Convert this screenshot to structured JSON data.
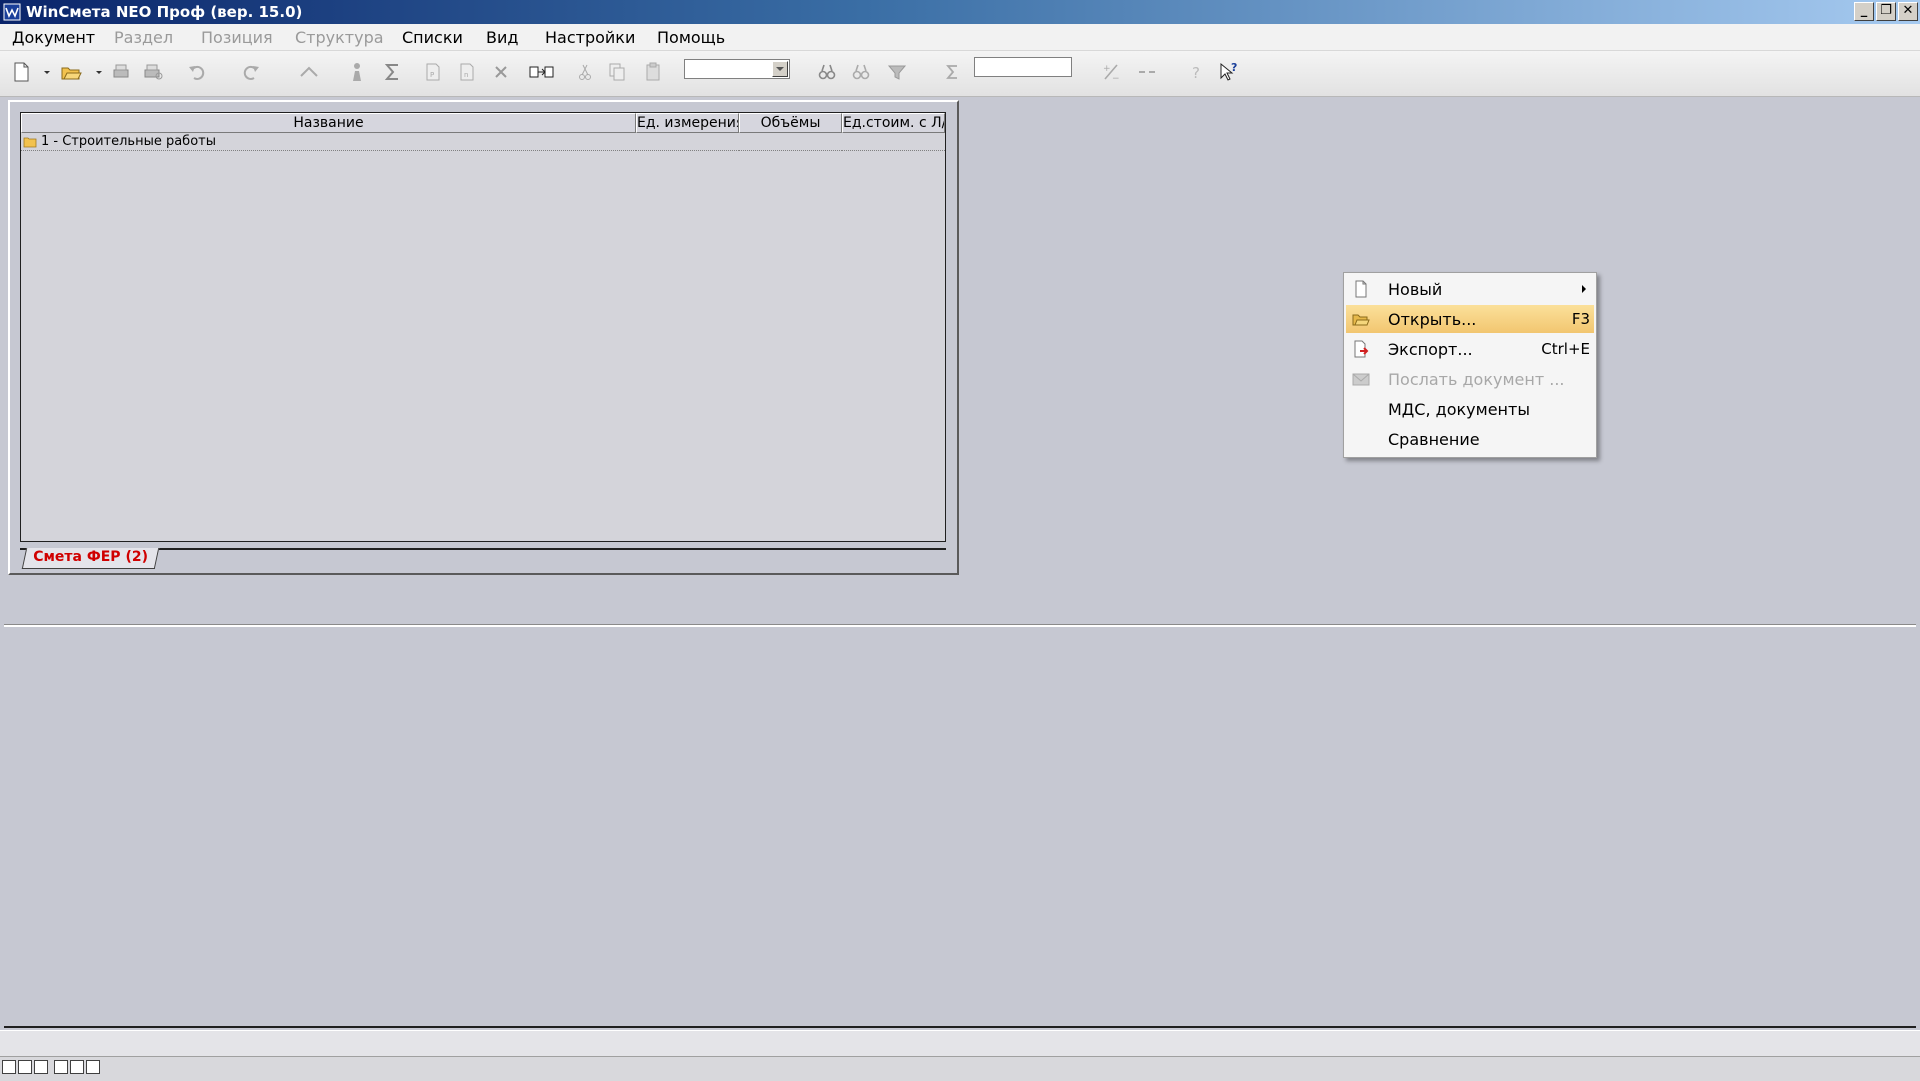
{
  "window": {
    "title": "WinСмета NEO Проф (вер. 15.0)",
    "controls": {
      "minimize": "_",
      "restore": "❐",
      "close": "✕"
    }
  },
  "menubar": [
    {
      "label": "Документ",
      "enabled": true
    },
    {
      "label": "Раздел",
      "enabled": false
    },
    {
      "label": "Позиция",
      "enabled": false
    },
    {
      "label": "Структура",
      "enabled": false
    },
    {
      "label": "Списки",
      "enabled": true
    },
    {
      "label": "Вид",
      "enabled": true
    },
    {
      "label": "Настройки",
      "enabled": true
    },
    {
      "label": "Помощь",
      "enabled": true
    }
  ],
  "toolbar": {
    "combo_value": "",
    "search_value": ""
  },
  "grid": {
    "columns": [
      "Название",
      "Ед. измерения",
      "Объёмы",
      "Ед.стоим. с Л/З"
    ],
    "rows": [
      {
        "name": "1 - Строительные работы",
        "unit": "",
        "volume": "",
        "unit_cost": ""
      }
    ]
  },
  "tabs": [
    {
      "label": "Смета ФЕР (2)"
    }
  ],
  "context_menu": {
    "items": [
      {
        "label": "Новый",
        "shortcut": "",
        "submenu": true,
        "enabled": true,
        "highlighted": false
      },
      {
        "label": "Открыть...",
        "shortcut": "F3",
        "submenu": false,
        "enabled": true,
        "highlighted": true
      },
      {
        "label": "Экспорт...",
        "shortcut": "Ctrl+E",
        "submenu": false,
        "enabled": true,
        "highlighted": false
      },
      {
        "label": "Послать документ ...",
        "shortcut": "",
        "submenu": false,
        "enabled": false,
        "highlighted": false
      },
      {
        "label": "МДС, документы",
        "shortcut": "",
        "submenu": false,
        "enabled": true,
        "highlighted": false
      },
      {
        "label": "Сравнение",
        "shortcut": "",
        "submenu": false,
        "enabled": true,
        "highlighted": false
      }
    ]
  },
  "colors": {
    "highlight": "#f2c670",
    "tab_text": "#d00000",
    "titlebar_start": "#0a246a"
  }
}
